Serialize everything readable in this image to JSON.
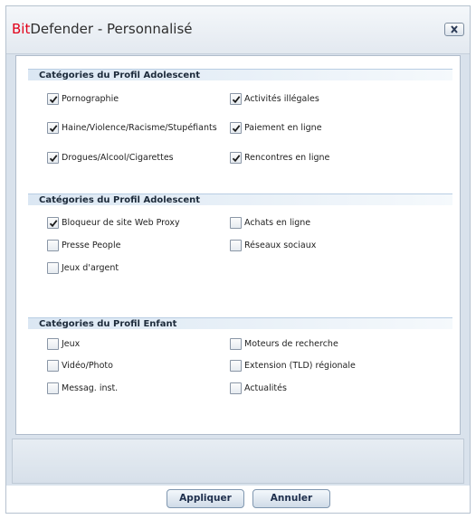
{
  "window": {
    "title_brand_red": "Bit",
    "title_rest": "Defender - Personnalisé"
  },
  "sections": [
    {
      "header": "Catégories du Profil Adolescent",
      "items": [
        {
          "label": "Pornographie",
          "checked": true
        },
        {
          "label": "Activités illégales",
          "checked": true
        },
        {
          "label": "Haine/Violence/Racisme/Stupéfiants",
          "checked": true
        },
        {
          "label": "Paiement en ligne",
          "checked": true
        },
        {
          "label": "Drogues/Alcool/Cigarettes",
          "checked": true
        },
        {
          "label": "Rencontres en ligne",
          "checked": true
        }
      ]
    },
    {
      "header": "Catégories du Profil Adolescent",
      "items": [
        {
          "label": "Bloqueur de site Web Proxy",
          "checked": true
        },
        {
          "label": "Achats en ligne",
          "checked": false
        },
        {
          "label": "Presse People",
          "checked": false
        },
        {
          "label": "Réseaux sociaux",
          "checked": false
        },
        {
          "label": "Jeux d'argent",
          "checked": false
        }
      ]
    },
    {
      "header": "Catégories du Profil Enfant",
      "items": [
        {
          "label": "Jeux",
          "checked": false
        },
        {
          "label": "Moteurs de recherche",
          "checked": false
        },
        {
          "label": "Vidéo/Photo",
          "checked": false
        },
        {
          "label": "Extension (TLD) régionale",
          "checked": false
        },
        {
          "label": "Messag. inst.",
          "checked": false
        },
        {
          "label": "Actualités",
          "checked": false
        }
      ]
    }
  ],
  "buttons": {
    "apply": "Appliquer",
    "cancel": "Annuler"
  },
  "colors": {
    "brand_red": "#e2001a",
    "check_color": "#1a1a1a"
  }
}
